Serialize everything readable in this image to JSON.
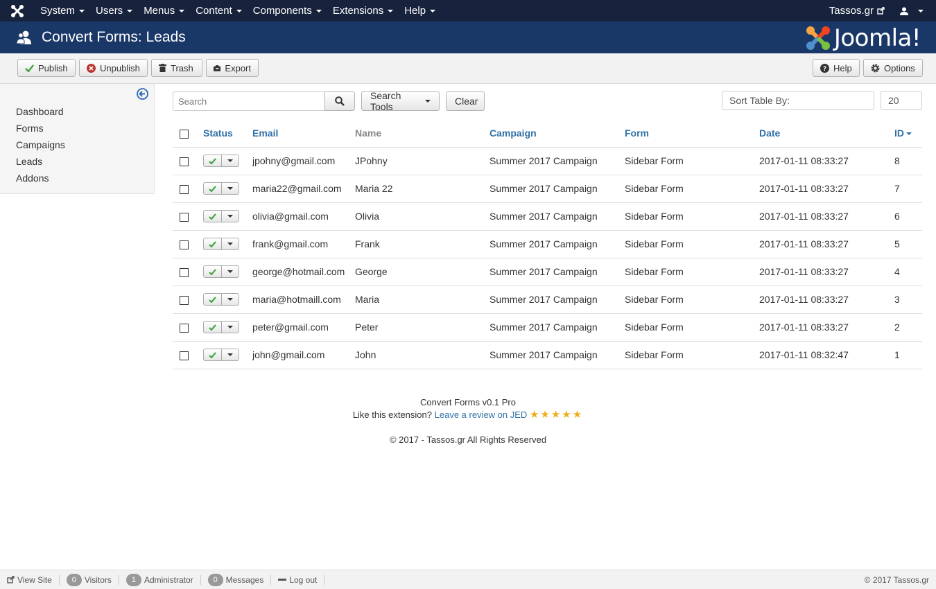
{
  "topnav": {
    "menu": [
      "System",
      "Users",
      "Menus",
      "Content",
      "Components",
      "Extensions",
      "Help"
    ],
    "site_name": "Tassos.gr"
  },
  "header": {
    "title": "Convert Forms: Leads",
    "logo_text": "Joomla!"
  },
  "toolbar": {
    "publish": "Publish",
    "unpublish": "Unpublish",
    "trash": "Trash",
    "export": "Export",
    "help": "Help",
    "options": "Options"
  },
  "sidebar": {
    "items": [
      "Dashboard",
      "Forms",
      "Campaigns",
      "Leads",
      "Addons"
    ]
  },
  "filters": {
    "search_placeholder": "Search",
    "search_tools": "Search Tools",
    "clear": "Clear",
    "sort_placeholder": "Sort Table By:",
    "limit": "20"
  },
  "table": {
    "headers": {
      "status": "Status",
      "email": "Email",
      "name": "Name",
      "campaign": "Campaign",
      "form": "Form",
      "date": "Date",
      "id": "ID"
    },
    "rows": [
      {
        "email": "jpohny@gmail.com",
        "name": "JPohny",
        "campaign": "Summer 2017 Campaign",
        "form": "Sidebar Form",
        "date": "2017-01-11 08:33:27",
        "id": "8"
      },
      {
        "email": "maria22@gmail.com",
        "name": "Maria 22",
        "campaign": "Summer 2017 Campaign",
        "form": "Sidebar Form",
        "date": "2017-01-11 08:33:27",
        "id": "7"
      },
      {
        "email": "olivia@gmail.com",
        "name": "Olivia",
        "campaign": "Summer 2017 Campaign",
        "form": "Sidebar Form",
        "date": "2017-01-11 08:33:27",
        "id": "6"
      },
      {
        "email": "frank@gmail.com",
        "name": "Frank",
        "campaign": "Summer 2017 Campaign",
        "form": "Sidebar Form",
        "date": "2017-01-11 08:33:27",
        "id": "5"
      },
      {
        "email": "george@hotmail.com",
        "name": "George",
        "campaign": "Summer 2017 Campaign",
        "form": "Sidebar Form",
        "date": "2017-01-11 08:33:27",
        "id": "4"
      },
      {
        "email": "maria@hotmaill.com",
        "name": "Maria",
        "campaign": "Summer 2017 Campaign",
        "form": "Sidebar Form",
        "date": "2017-01-11 08:33:27",
        "id": "3"
      },
      {
        "email": "peter@gmail.com",
        "name": "Peter",
        "campaign": "Summer 2017 Campaign",
        "form": "Sidebar Form",
        "date": "2017-01-11 08:33:27",
        "id": "2"
      },
      {
        "email": "john@gmail.com",
        "name": "John",
        "campaign": "Summer 2017 Campaign",
        "form": "Sidebar Form",
        "date": "2017-01-11 08:32:47",
        "id": "1"
      }
    ]
  },
  "ext_footer": {
    "version": "Convert Forms v0.1 Pro",
    "like_text": "Like this extension?",
    "review_link": "Leave a review on JED",
    "copyright": "© 2017 - Tassos.gr All Rights Reserved"
  },
  "statusbar": {
    "view_site": "View Site",
    "visitors_count": "0",
    "visitors_label": "Visitors",
    "admin_count": "1",
    "admin_label": "Administrator",
    "messages_count": "0",
    "messages_label": "Messages",
    "logout": "Log out",
    "copyright": "© 2017 Tassos.gr"
  },
  "colors": {
    "navbar": "#17233c",
    "header": "#1a3867",
    "link": "#3071a9",
    "check": "#46a546",
    "unpublish": "#bd362f",
    "star": "#f0ad1a"
  }
}
